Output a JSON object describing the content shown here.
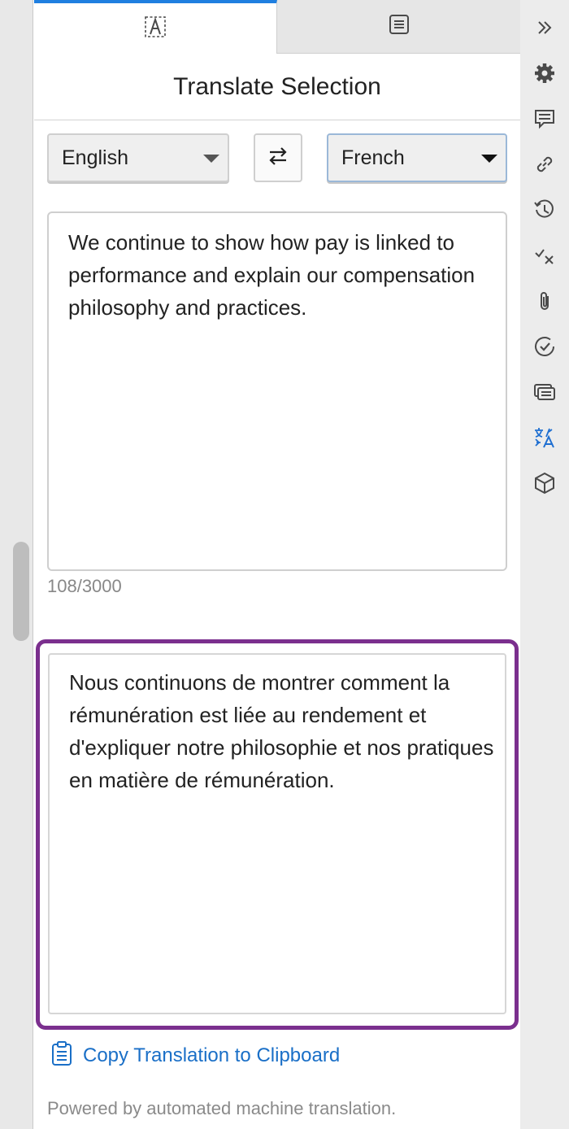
{
  "tabs": [
    {
      "name": "translate-selection-tab",
      "icon": "text-selection-icon"
    },
    {
      "name": "translate-document-tab",
      "icon": "document-icon"
    }
  ],
  "panel": {
    "title": "Translate Selection",
    "source_language": "English",
    "target_language": "French",
    "source_text": "We continue to show how pay is linked to performance and explain our compensation philosophy and practices.",
    "char_count": "108/3000",
    "translated_text": "Nous continuons de montrer comment la rémunération est liée au rendement et d'expliquer notre philosophie et nos pratiques en matière de rémunération.",
    "copy_label": "Copy Translation to Clipboard",
    "footer": "Powered by automated machine translation."
  },
  "rail": {
    "icons": [
      "collapse-icon",
      "gear-icon",
      "comment-icon",
      "link-icon",
      "history-icon",
      "check-cross-icon",
      "paperclip-icon",
      "check-circle-icon",
      "list-card-icon",
      "translate-icon",
      "cube-icon"
    ],
    "active": "translate-icon",
    "accent": "#1f6fd1"
  },
  "colors": {
    "result_border": "#7b2f8e",
    "tab_active": "#1f7fe0",
    "link": "#1a6fc7"
  }
}
